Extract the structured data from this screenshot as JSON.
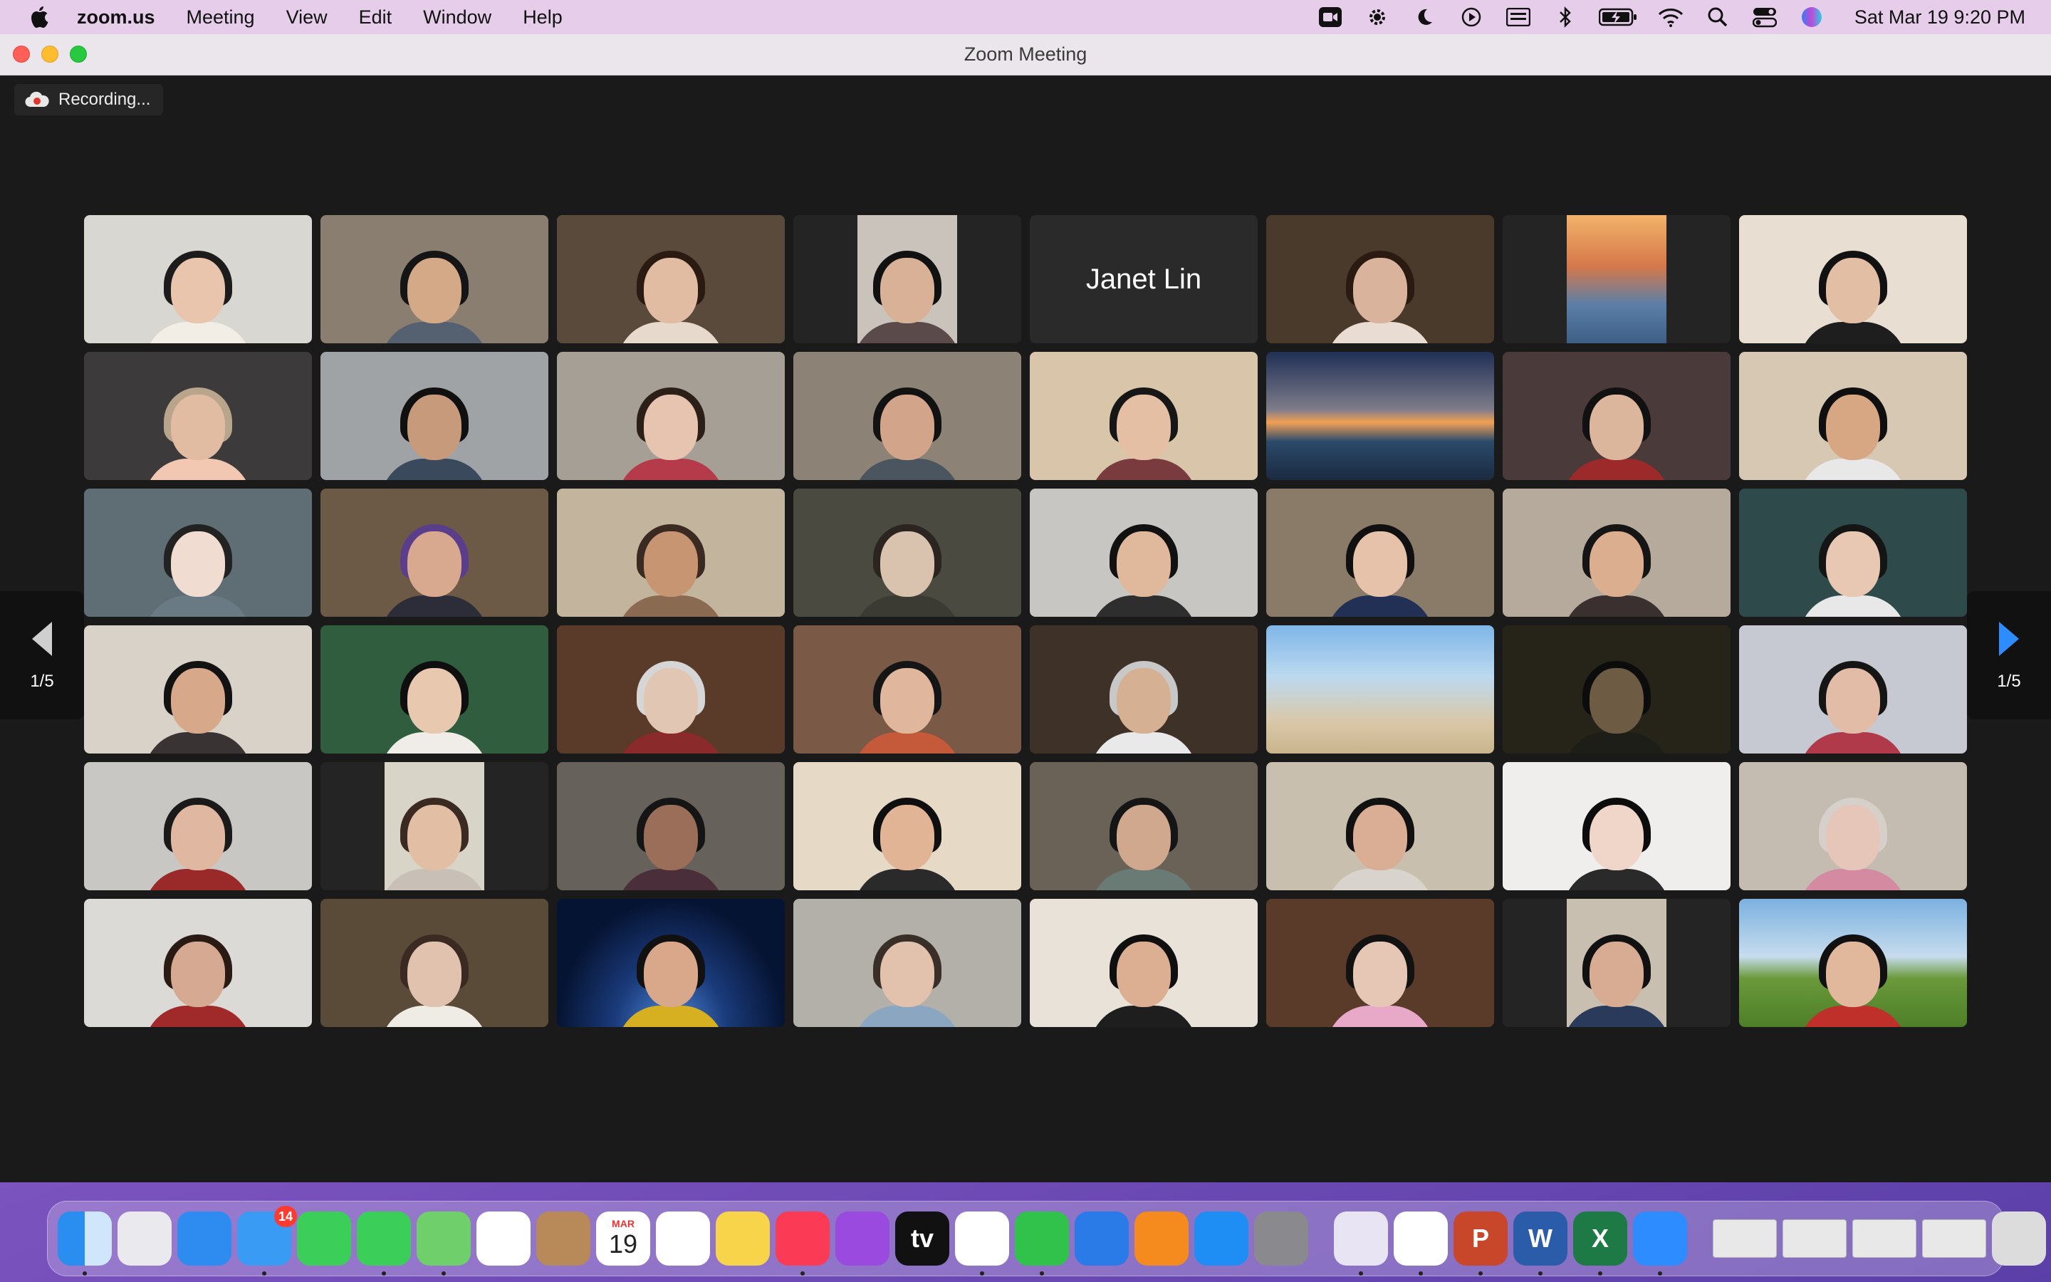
{
  "menubar": {
    "app_name": "zoom.us",
    "menus": [
      "Meeting",
      "View",
      "Edit",
      "Window",
      "Help"
    ],
    "clock": "Sat Mar 19  9:20 PM",
    "status_icons": [
      "zoom-video-icon",
      "gear-icon",
      "moon-icon",
      "play-icon",
      "keyboard-icon",
      "bluetooth-icon",
      "battery-icon",
      "wifi-icon",
      "search-icon",
      "control-center-icon",
      "siri-icon"
    ]
  },
  "window": {
    "title": "Zoom Meeting",
    "recording_label": "Recording...",
    "page_indicator_left": "1/5",
    "page_indicator_right": "1/5"
  },
  "tiles": [
    {
      "type": "video",
      "bg": "#d9d7d1",
      "skin": "#e8c5ac",
      "hair": "#1c1c1c",
      "shirt": "#f2eee6"
    },
    {
      "type": "video",
      "bg": "#8a7e70",
      "skin": "#d4a987",
      "hair": "#151515",
      "shirt": "#556070"
    },
    {
      "type": "video",
      "bg": "#5a4a3c",
      "skin": "#e2bba3",
      "hair": "#2a1a12",
      "shirt": "#e7d9cc",
      "active": true
    },
    {
      "type": "video",
      "bg": "#c9c3bb",
      "skin": "#d8b196",
      "hair": "#111",
      "shirt": "#5b4a4a",
      "narrow": true
    },
    {
      "type": "name",
      "name": "Janet Lin"
    },
    {
      "type": "video",
      "bg": "#4a3a2c",
      "skin": "#d9b39b",
      "hair": "#2a1a12",
      "shirt": "#e9dcd3"
    },
    {
      "type": "scene",
      "bg": "linear-gradient(180deg,#f2b36a 0%,#d5784a 40%,#5b7fa8 70%,#3e5f86 100%)",
      "narrow": true
    },
    {
      "type": "video",
      "bg": "#e8dfd2",
      "skin": "#e2bfa4",
      "hair": "#111",
      "shirt": "#1e1e1e"
    },
    {
      "type": "video",
      "bg": "#3c3a3a",
      "skin": "#e1bca3",
      "hair": "#b9a58c",
      "shirt": "#f3c8b3"
    },
    {
      "type": "video",
      "bg": "#9fa3a6",
      "skin": "#c89a7c",
      "hair": "#101010",
      "shirt": "#3a4a5c"
    },
    {
      "type": "video",
      "bg": "#a59f95",
      "skin": "#e6c4b0",
      "hair": "#2c1f18",
      "shirt": "#b53a4a"
    },
    {
      "type": "video",
      "bg": "#8c8275",
      "skin": "#d2a58a",
      "hair": "#121212",
      "shirt": "#4a5560"
    },
    {
      "type": "video",
      "bg": "#d9c6aa",
      "skin": "#e4bfa3",
      "hair": "#161616",
      "shirt": "#7a3b3e"
    },
    {
      "type": "scene",
      "bg": "linear-gradient(180deg,#1f2f55 0%,#7e7c8a 45%,#f2a055 55%,#2b4a6a 70%,#1a2a40 100%)"
    },
    {
      "type": "video",
      "bg": "#4a3b3a",
      "skin": "#dcb69c",
      "hair": "#111",
      "shirt": "#9c2a2a"
    },
    {
      "type": "video",
      "bg": "#d6c8b2",
      "skin": "#d7a784",
      "hair": "#0f0f0f",
      "shirt": "#e8e8e8"
    },
    {
      "type": "video",
      "bg": "#5e6e74",
      "skin": "#f0dcd0",
      "hair": "#222",
      "shirt": "#6a7a84"
    },
    {
      "type": "video",
      "bg": "#6c5a46",
      "skin": "#d9a98f",
      "hair": "#5a3e8c",
      "shirt": "#2d2d3a"
    },
    {
      "type": "video",
      "bg": "#c2b49d",
      "skin": "#c79572",
      "hair": "#3a2a22",
      "shirt": "#8a6a50"
    },
    {
      "type": "video",
      "bg": "#4a4a40",
      "skin": "#d9c2ae",
      "hair": "#2b2420",
      "shirt": "#3b3a33"
    },
    {
      "type": "video",
      "bg": "#c8c6c2",
      "skin": "#e0b89c",
      "hair": "#111",
      "shirt": "#2e2e2e"
    },
    {
      "type": "video",
      "bg": "#8a7a68",
      "skin": "#e6c2aa",
      "hair": "#101010",
      "shirt": "#223055"
    },
    {
      "type": "video",
      "bg": "#b5aa9c",
      "skin": "#dcae90",
      "hair": "#151515",
      "shirt": "#3a3030"
    },
    {
      "type": "video",
      "bg": "#2f4a4a",
      "skin": "#e8c8b2",
      "hair": "#151515",
      "shirt": "#e8e8e8"
    },
    {
      "type": "video",
      "bg": "#d8d2c8",
      "skin": "#d8a88a",
      "hair": "#121212",
      "shirt": "#3a3333"
    },
    {
      "type": "video",
      "bg": "#2f5d3e",
      "skin": "#e9c8b0",
      "hair": "#0f0f0f",
      "shirt": "#f0ede8"
    },
    {
      "type": "video",
      "bg": "#5a3a28",
      "skin": "#e2c6b4",
      "hair": "#d6d6d6",
      "shirt": "#8a2a2a"
    },
    {
      "type": "video",
      "bg": "#7a5a46",
      "skin": "#e0b69c",
      "hair": "#151515",
      "shirt": "#c45a3a"
    },
    {
      "type": "video",
      "bg": "#3e3228",
      "skin": "#d6b092",
      "hair": "#c8c8c8",
      "shirt": "#e9e9e9"
    },
    {
      "type": "scene",
      "bg": "linear-gradient(180deg,#7fb6e8 0%,#bcd9ef 40%,#d9c8a8 75%,#c9b48c 100%)"
    },
    {
      "type": "video",
      "bg": "#262418",
      "skin": "#6e5b44",
      "hair": "#0c0c0c",
      "shirt": "#1e1e18"
    },
    {
      "type": "video",
      "bg": "#c6c9d2",
      "skin": "#e2bca6",
      "hair": "#151515",
      "shirt": "#b03a4a"
    },
    {
      "type": "video",
      "bg": "#c9c7c3",
      "skin": "#e0b8a2",
      "hair": "#1a1a1a",
      "shirt": "#9a2a2a"
    },
    {
      "type": "video",
      "bg": "#d8d4c8",
      "skin": "#e2bea4",
      "hair": "#3a2a22",
      "shirt": "#c8c0b6",
      "narrow": true
    },
    {
      "type": "video",
      "bg": "#66615a",
      "skin": "#9a6e58",
      "hair": "#151515",
      "shirt": "#4a2f3a"
    },
    {
      "type": "video",
      "bg": "#e6dac6",
      "skin": "#e2b496",
      "hair": "#0f0f0f",
      "shirt": "#2a2a2a"
    },
    {
      "type": "video",
      "bg": "#6a6257",
      "skin": "#cfa88e",
      "hair": "#151515",
      "shirt": "#6a7a74"
    },
    {
      "type": "video",
      "bg": "#c9bfae",
      "skin": "#d9ae94",
      "hair": "#111",
      "shirt": "#d8d3cc"
    },
    {
      "type": "video",
      "bg": "#f0eeec",
      "skin": "#f0d6c8",
      "hair": "#0c0c0c",
      "shirt": "#2a2a2a"
    },
    {
      "type": "video",
      "bg": "#c4bcb0",
      "skin": "#e6c6b8",
      "hair": "#d6d0ca",
      "shirt": "#d48aa0"
    },
    {
      "type": "video",
      "bg": "#dcdad6",
      "skin": "#d6aa92",
      "hair": "#2a1a14",
      "shirt": "#a02a2a"
    },
    {
      "type": "video",
      "bg": "#5a4a38",
      "skin": "#e0c2ae",
      "hair": "#3a2a22",
      "shirt": "#efece6"
    },
    {
      "type": "scene",
      "bg": "radial-gradient(ellipse at 50% 100%,#4c8ad8 0%,#1a3a7a 35%,#061433 70%)",
      "person": {
        "skin": "#d9a88a",
        "hair": "#111",
        "shirt": "#d6b020"
      }
    },
    {
      "type": "video",
      "bg": "#b2b0a8",
      "skin": "#e2c2ac",
      "hair": "#3a2f28",
      "shirt": "#8aa6c0"
    },
    {
      "type": "video",
      "bg": "#e8e2d8",
      "skin": "#dcae92",
      "hair": "#0f0f0f",
      "shirt": "#1e1e1e"
    },
    {
      "type": "video",
      "bg": "#5a3a28",
      "skin": "#e6c6b4",
      "hair": "#121212",
      "shirt": "#e8a8c8"
    },
    {
      "type": "video",
      "bg": "#c9bfb0",
      "skin": "#d8ac92",
      "hair": "#111",
      "shirt": "#2a3a5a",
      "narrow": true
    },
    {
      "type": "scene",
      "bg": "linear-gradient(180deg,#7bb1e0 0%,#c7dcee 45%,#6a9a3a 62%,#4e7e28 100%)",
      "person": {
        "skin": "#e2b89c",
        "hair": "#111",
        "shirt": "#c0302a"
      }
    }
  ],
  "dock": {
    "apps": [
      {
        "name": "finder-icon",
        "bg": "linear-gradient(90deg,#2a8ef0 50%,#cfe6fb 50%)"
      },
      {
        "name": "launchpad-icon",
        "bg": "#e9e9ee"
      },
      {
        "name": "safari-icon",
        "bg": "#2e8cf0"
      },
      {
        "name": "mail-icon",
        "bg": "#3a9bf5",
        "badge": "14"
      },
      {
        "name": "facetime-icon",
        "bg": "#3bcf5a"
      },
      {
        "name": "messages-icon",
        "bg": "#3bcf5a"
      },
      {
        "name": "maps-icon",
        "bg": "#6fcf6a"
      },
      {
        "name": "photos-icon",
        "bg": "#ffffff"
      },
      {
        "name": "contacts-icon",
        "bg": "#b88a5a"
      },
      {
        "name": "calendar-icon",
        "bg": "#ffffff",
        "label_top": "MAR",
        "label": "19"
      },
      {
        "name": "reminders-icon",
        "bg": "#ffffff"
      },
      {
        "name": "notes-icon",
        "bg": "#f7d44a"
      },
      {
        "name": "music-icon",
        "bg": "#fb3b55"
      },
      {
        "name": "podcasts-icon",
        "bg": "#9b4ae0"
      },
      {
        "name": "apple-tv-icon",
        "bg": "#111111",
        "label": "tv"
      },
      {
        "name": "news-icon",
        "bg": "#ffffff"
      },
      {
        "name": "numbers-icon",
        "bg": "#30c24a"
      },
      {
        "name": "keynote-icon",
        "bg": "#2a7ae8"
      },
      {
        "name": "pages-icon",
        "bg": "#f58a1e"
      },
      {
        "name": "app-store-icon",
        "bg": "#1e8ef5"
      },
      {
        "name": "system-preferences-icon",
        "bg": "#8a8a8e"
      }
    ],
    "apps2": [
      {
        "name": "video-app-icon",
        "bg": "#e8e4f4"
      },
      {
        "name": "chrome-icon",
        "bg": "#ffffff"
      },
      {
        "name": "powerpoint-icon",
        "bg": "#c8472a",
        "label": "P"
      },
      {
        "name": "word-icon",
        "bg": "#2a5caa",
        "label": "W"
      },
      {
        "name": "excel-icon",
        "bg": "#1e7a44",
        "label": "X"
      },
      {
        "name": "zoom-icon",
        "bg": "#2d8cff"
      }
    ],
    "minimized": [
      {
        "name": "minimized-window-1",
        "bg": "#e8e8e8"
      },
      {
        "name": "minimized-window-2",
        "bg": "#e8e8e8"
      },
      {
        "name": "minimized-window-3",
        "bg": "#e8e8e8"
      },
      {
        "name": "minimized-window-4",
        "bg": "#e8e8e8"
      }
    ],
    "trash": {
      "name": "trash-icon",
      "bg": "#dcdcdc"
    }
  }
}
